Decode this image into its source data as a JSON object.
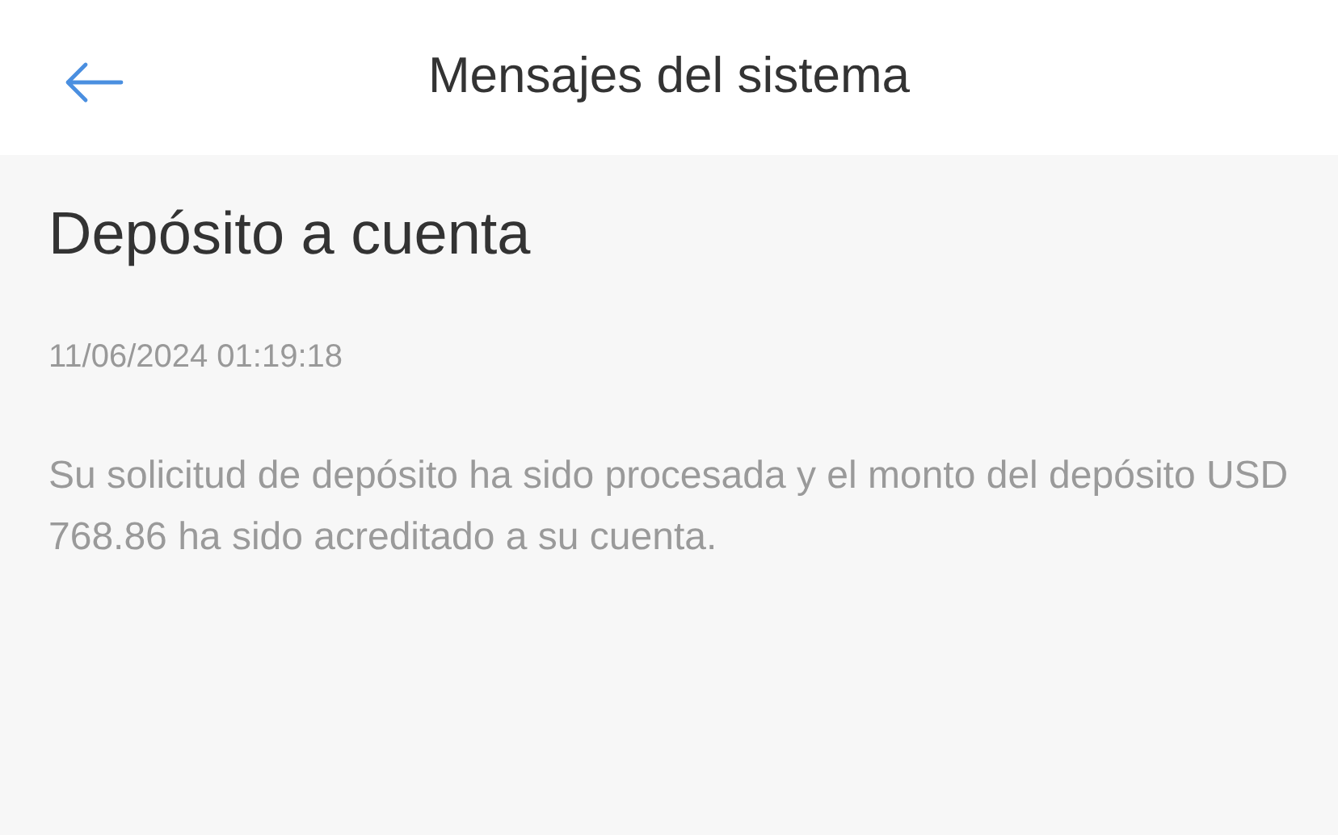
{
  "header": {
    "title": "Mensajes del sistema"
  },
  "message": {
    "title": "Depósito a cuenta",
    "timestamp": "11/06/2024 01:19:18",
    "body": "Su solicitud de depósito ha sido procesada y el monto del depósito USD 768.86 ha sido acreditado a su cuenta."
  }
}
